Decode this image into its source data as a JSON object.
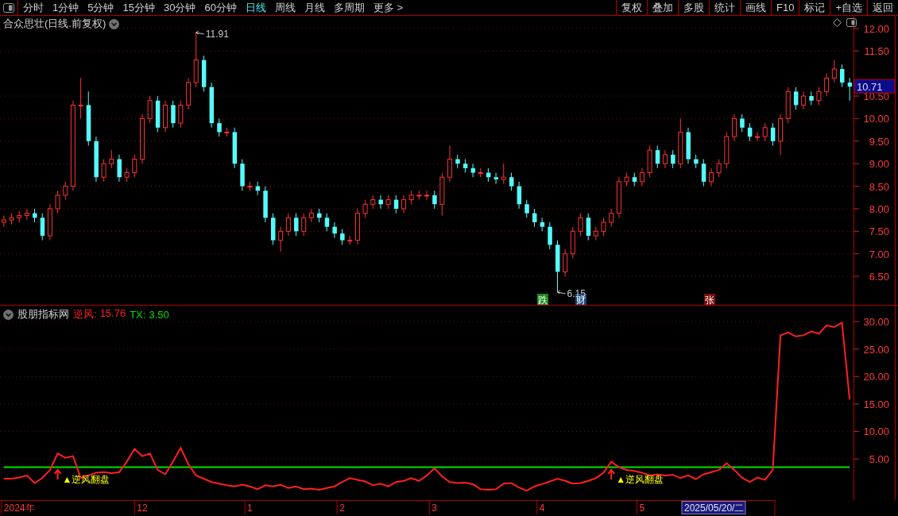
{
  "toolbar": {
    "periods": [
      {
        "label": "分时",
        "selected": false
      },
      {
        "label": "1分钟",
        "selected": false
      },
      {
        "label": "5分钟",
        "selected": false
      },
      {
        "label": "15分钟",
        "selected": false
      },
      {
        "label": "30分钟",
        "selected": false
      },
      {
        "label": "60分钟",
        "selected": false
      },
      {
        "label": "日线",
        "selected": true
      },
      {
        "label": "周线",
        "selected": false
      },
      {
        "label": "月线",
        "selected": false
      },
      {
        "label": "多周期",
        "selected": false
      },
      {
        "label": "更多 >",
        "selected": false
      }
    ],
    "actions": [
      "复权",
      "叠加",
      "多股",
      "统计",
      "画线",
      "F10",
      "标记",
      "+自选",
      "返回"
    ]
  },
  "price_panel": {
    "title": "合众思壮(日线.前复权)",
    "last_price": "10.71",
    "chart_data": {
      "type": "candlestick",
      "categories": [
        null,
        null,
        null,
        null,
        null,
        null,
        null,
        null,
        null,
        null,
        null,
        null,
        null,
        null,
        null,
        null,
        null,
        null,
        null,
        null,
        null,
        null,
        null,
        null,
        null,
        null,
        null,
        null,
        null,
        null,
        null,
        null,
        null,
        null,
        null,
        null,
        null,
        null,
        null,
        null,
        null,
        null,
        null,
        null,
        null,
        null,
        null,
        null,
        null,
        null,
        null,
        null,
        null,
        null,
        null,
        null,
        null,
        null,
        null,
        null,
        null,
        null,
        null,
        null,
        null,
        null,
        null,
        null,
        null,
        null,
        null,
        null,
        null,
        null,
        null,
        null,
        null,
        null,
        null,
        null,
        null,
        null,
        null,
        null,
        null,
        null,
        null,
        null,
        null,
        null,
        null,
        null,
        null,
        null,
        null,
        null,
        null,
        null,
        null,
        null,
        null,
        null,
        null,
        null,
        null,
        null,
        null,
        null,
        null,
        null,
        null
      ],
      "ohlc": [
        [
          7.7,
          7.85,
          7.6,
          7.75
        ],
        [
          7.75,
          7.9,
          7.65,
          7.8
        ],
        [
          7.8,
          7.95,
          7.7,
          7.85
        ],
        [
          7.85,
          8.0,
          7.75,
          7.9
        ],
        [
          7.9,
          8.0,
          7.7,
          7.8
        ],
        [
          7.8,
          7.9,
          7.3,
          7.4
        ],
        [
          7.4,
          8.1,
          7.3,
          8.0
        ],
        [
          8.0,
          8.4,
          7.9,
          8.3
        ],
        [
          8.3,
          8.6,
          8.2,
          8.5
        ],
        [
          8.5,
          10.4,
          8.4,
          10.3
        ],
        [
          10.3,
          10.9,
          10.0,
          10.3
        ],
        [
          10.3,
          10.6,
          9.4,
          9.5
        ],
        [
          9.5,
          9.6,
          8.6,
          8.7
        ],
        [
          8.7,
          9.1,
          8.6,
          9.0
        ],
        [
          9.0,
          9.3,
          8.9,
          9.1
        ],
        [
          9.1,
          9.2,
          8.6,
          8.7
        ],
        [
          8.7,
          8.9,
          8.6,
          8.8
        ],
        [
          8.8,
          9.2,
          8.7,
          9.1
        ],
        [
          9.1,
          10.1,
          9.0,
          10.0
        ],
        [
          10.0,
          10.5,
          9.9,
          10.4
        ],
        [
          10.4,
          10.5,
          9.7,
          9.8
        ],
        [
          9.8,
          10.4,
          9.7,
          10.3
        ],
        [
          10.3,
          10.4,
          9.8,
          9.9
        ],
        [
          9.9,
          10.4,
          9.8,
          10.3
        ],
        [
          10.3,
          10.9,
          10.2,
          10.8
        ],
        [
          10.8,
          11.91,
          10.7,
          11.3
        ],
        [
          11.3,
          11.4,
          10.6,
          10.7
        ],
        [
          10.7,
          10.8,
          9.8,
          9.9
        ],
        [
          9.9,
          10.0,
          9.6,
          9.7
        ],
        [
          9.7,
          9.8,
          9.6,
          9.7
        ],
        [
          9.7,
          9.8,
          8.9,
          9.0
        ],
        [
          9.0,
          9.1,
          8.4,
          8.5
        ],
        [
          8.5,
          8.6,
          8.4,
          8.5
        ],
        [
          8.5,
          8.6,
          8.3,
          8.4
        ],
        [
          8.4,
          8.5,
          7.7,
          7.8
        ],
        [
          7.8,
          7.9,
          7.2,
          7.3
        ],
        [
          7.3,
          7.6,
          7.05,
          7.5
        ],
        [
          7.5,
          7.9,
          7.4,
          7.8
        ],
        [
          7.8,
          7.9,
          7.4,
          7.5
        ],
        [
          7.5,
          7.9,
          7.4,
          7.8
        ],
        [
          7.8,
          8.0,
          7.7,
          7.9
        ],
        [
          7.9,
          8.0,
          7.7,
          7.8
        ],
        [
          7.8,
          7.9,
          7.5,
          7.6
        ],
        [
          7.6,
          7.7,
          7.35,
          7.45
        ],
        [
          7.45,
          7.55,
          7.2,
          7.3
        ],
        [
          7.3,
          7.4,
          7.2,
          7.3
        ],
        [
          7.3,
          8.0,
          7.2,
          7.9
        ],
        [
          7.9,
          8.2,
          7.8,
          8.1
        ],
        [
          8.1,
          8.3,
          8.0,
          8.2
        ],
        [
          8.2,
          8.3,
          8.0,
          8.1
        ],
        [
          8.1,
          8.3,
          8.0,
          8.2
        ],
        [
          8.2,
          8.3,
          7.9,
          8.0
        ],
        [
          8.0,
          8.3,
          7.9,
          8.2
        ],
        [
          8.2,
          8.4,
          8.1,
          8.3
        ],
        [
          8.3,
          8.4,
          8.2,
          8.3
        ],
        [
          8.3,
          8.4,
          8.2,
          8.3
        ],
        [
          8.3,
          8.4,
          8.0,
          8.1
        ],
        [
          8.1,
          8.8,
          7.85,
          8.7
        ],
        [
          8.7,
          9.4,
          8.6,
          9.1
        ],
        [
          9.1,
          9.2,
          8.9,
          9.0
        ],
        [
          9.0,
          9.1,
          8.8,
          8.9
        ],
        [
          8.9,
          9.0,
          8.7,
          8.8
        ],
        [
          8.8,
          8.9,
          8.7,
          8.8
        ],
        [
          8.8,
          8.9,
          8.6,
          8.7
        ],
        [
          8.7,
          8.8,
          8.55,
          8.65
        ],
        [
          8.65,
          9.0,
          8.55,
          8.7
        ],
        [
          8.7,
          8.8,
          8.4,
          8.5
        ],
        [
          8.5,
          8.6,
          8.0,
          8.1
        ],
        [
          8.1,
          8.2,
          7.8,
          7.9
        ],
        [
          7.9,
          8.0,
          7.6,
          7.7
        ],
        [
          7.7,
          7.8,
          7.5,
          7.6
        ],
        [
          7.6,
          7.7,
          7.1,
          7.2
        ],
        [
          7.2,
          7.3,
          6.15,
          6.6
        ],
        [
          6.6,
          7.1,
          6.5,
          7.0
        ],
        [
          7.0,
          7.6,
          6.9,
          7.5
        ],
        [
          7.5,
          7.9,
          7.4,
          7.8
        ],
        [
          7.8,
          7.9,
          7.3,
          7.4
        ],
        [
          7.4,
          7.6,
          7.3,
          7.5
        ],
        [
          7.5,
          7.8,
          7.4,
          7.7
        ],
        [
          7.7,
          8.0,
          7.6,
          7.9
        ],
        [
          7.9,
          8.7,
          7.8,
          8.6
        ],
        [
          8.6,
          8.8,
          8.5,
          8.7
        ],
        [
          8.7,
          8.8,
          8.5,
          8.6
        ],
        [
          8.6,
          8.9,
          8.5,
          8.8
        ],
        [
          8.8,
          9.4,
          8.7,
          9.3
        ],
        [
          9.3,
          9.4,
          8.9,
          9.0
        ],
        [
          9.0,
          9.3,
          8.9,
          9.2
        ],
        [
          9.2,
          9.3,
          8.9,
          9.0
        ],
        [
          9.0,
          10.0,
          8.9,
          9.7
        ],
        [
          9.7,
          9.8,
          9.0,
          9.1
        ],
        [
          9.1,
          9.2,
          8.9,
          9.0
        ],
        [
          9.0,
          9.1,
          8.5,
          8.6
        ],
        [
          8.6,
          8.9,
          8.5,
          8.8
        ],
        [
          8.8,
          9.1,
          8.7,
          9.0
        ],
        [
          9.0,
          9.7,
          8.9,
          9.6
        ],
        [
          9.6,
          10.1,
          9.5,
          10.0
        ],
        [
          10.0,
          10.1,
          9.7,
          9.8
        ],
        [
          9.8,
          9.9,
          9.5,
          9.6
        ],
        [
          9.6,
          9.7,
          9.5,
          9.6
        ],
        [
          9.6,
          9.9,
          9.5,
          9.8
        ],
        [
          9.8,
          9.9,
          9.4,
          9.5
        ],
        [
          9.5,
          10.1,
          9.2,
          10.0
        ],
        [
          10.0,
          10.7,
          9.9,
          10.6
        ],
        [
          10.6,
          10.7,
          10.2,
          10.3
        ],
        [
          10.3,
          10.6,
          10.2,
          10.5
        ],
        [
          10.5,
          10.6,
          10.3,
          10.4
        ],
        [
          10.4,
          10.7,
          10.3,
          10.6
        ],
        [
          10.6,
          11.0,
          10.5,
          10.9
        ],
        [
          10.9,
          11.3,
          10.8,
          11.1
        ],
        [
          11.1,
          11.2,
          10.7,
          10.8
        ],
        [
          10.8,
          10.9,
          10.4,
          10.71
        ]
      ],
      "ylim": [
        5.85,
        12.28
      ],
      "grid": true,
      "yticks": [
        {
          "value": 12,
          "label": "12.00"
        },
        {
          "value": 11.5,
          "label": "11.50"
        },
        {
          "value": 10.5,
          "label": "10.50"
        },
        {
          "value": 10,
          "label": "10.00"
        },
        {
          "value": 9.5,
          "label": "9.50"
        },
        {
          "value": 9,
          "label": "9.00"
        },
        {
          "value": 8.5,
          "label": "8.50"
        },
        {
          "value": 8,
          "label": "8.00"
        },
        {
          "value": 7.5,
          "label": "7.50"
        },
        {
          "value": 7,
          "label": "7.00"
        },
        {
          "value": 6.5,
          "label": "6.50"
        }
      ]
    },
    "extremes": [
      {
        "text": "11.91"
      },
      {
        "text": "6.15"
      }
    ],
    "event_badges": [
      {
        "text": "跌",
        "color": "#1c8a1c"
      },
      {
        "text": "财",
        "color": "#18477a"
      },
      {
        "text": "张",
        "color": "#7a0c0c"
      }
    ]
  },
  "indicator_panel": {
    "name": "股朋指标网",
    "readings": [
      "15.76",
      "3.50"
    ],
    "cursor_date": "2025/05/20/二",
    "chart_data": {
      "type": "line",
      "categories": [
        null,
        null,
        "2024年",
        null,
        null,
        null,
        null,
        null,
        null,
        null,
        null,
        null,
        null,
        null,
        null,
        null,
        null,
        null,
        "12",
        null,
        null,
        null,
        null,
        null,
        null,
        null,
        null,
        null,
        null,
        null,
        null,
        null,
        "1",
        null,
        null,
        null,
        null,
        null,
        null,
        null,
        null,
        null,
        null,
        null,
        "2",
        null,
        null,
        null,
        null,
        null,
        null,
        null,
        null,
        null,
        null,
        null,
        "3",
        null,
        null,
        null,
        null,
        null,
        null,
        null,
        null,
        null,
        null,
        null,
        null,
        null,
        "4",
        null,
        null,
        null,
        null,
        null,
        null,
        null,
        null,
        null,
        null,
        null,
        null,
        "5",
        null,
        null,
        null,
        null,
        null,
        null,
        null,
        null,
        null,
        null,
        null,
        null,
        null,
        null,
        null,
        null,
        null,
        null,
        null,
        null,
        null,
        null,
        null,
        null,
        null,
        null,
        null
      ],
      "series": [
        {
          "name": "逆风:",
          "color": "#ff2020",
          "values": [
            1.4,
            1.4,
            1.6,
            2.0,
            0.6,
            1.5,
            3.0,
            6.0,
            5.2,
            5.5,
            1.5,
            2.0,
            2.5,
            2.6,
            2.4,
            2.6,
            4.5,
            6.8,
            5.5,
            6.0,
            3.0,
            2.2,
            4.5,
            7.0,
            4.0,
            2.0,
            1.4,
            0.8,
            0.5,
            0.2,
            0.0,
            0.3,
            0.0,
            -0.5,
            0.2,
            0.0,
            0.3,
            -0.3,
            0.0,
            -0.5,
            -0.4,
            -0.6,
            -0.3,
            0.0,
            0.8,
            1.5,
            1.2,
            0.9,
            0.2,
            0.5,
            0.0,
            0.8,
            1.0,
            1.5,
            1.0,
            2.0,
            3.3,
            1.8,
            0.8,
            0.6,
            0.7,
            0.4,
            -0.5,
            -0.6,
            -0.5,
            0.5,
            0.6,
            -0.2,
            -0.8,
            0.0,
            0.4,
            0.9,
            1.4,
            1.0,
            0.5,
            0.6,
            1.0,
            1.5,
            2.5,
            4.5,
            3.5,
            3.0,
            2.8,
            2.5,
            2.0,
            2.2,
            2.0,
            2.1,
            1.5,
            2.0,
            1.3,
            2.2,
            2.6,
            3.0,
            4.2,
            3.0,
            1.6,
            0.8,
            1.6,
            1.2,
            3.0,
            27.5,
            28.0,
            27.3,
            27.5,
            28.2,
            27.8,
            29.3,
            29.0,
            29.8,
            15.8
          ]
        },
        {
          "name": "TX:",
          "color": "#00e000",
          "values": [
            3.5,
            3.5,
            3.5,
            3.5,
            3.5,
            3.5,
            3.5,
            3.5,
            3.5,
            3.5,
            3.5,
            3.5,
            3.5,
            3.5,
            3.5,
            3.5,
            3.5,
            3.5,
            3.5,
            3.5,
            3.5,
            3.5,
            3.5,
            3.5,
            3.5,
            3.5,
            3.5,
            3.5,
            3.5,
            3.5,
            3.5,
            3.5,
            3.5,
            3.5,
            3.5,
            3.5,
            3.5,
            3.5,
            3.5,
            3.5,
            3.5,
            3.5,
            3.5,
            3.5,
            3.5,
            3.5,
            3.5,
            3.5,
            3.5,
            3.5,
            3.5,
            3.5,
            3.5,
            3.5,
            3.5,
            3.5,
            3.5,
            3.5,
            3.5,
            3.5,
            3.5,
            3.5,
            3.5,
            3.5,
            3.5,
            3.5,
            3.5,
            3.5,
            3.5,
            3.5,
            3.5,
            3.5,
            3.5,
            3.5,
            3.5,
            3.5,
            3.5,
            3.5,
            3.5,
            3.5,
            3.5,
            3.5,
            3.5,
            3.5,
            3.5,
            3.5,
            3.5,
            3.5,
            3.5,
            3.5,
            3.5,
            3.5,
            3.5,
            3.5,
            3.5,
            3.5,
            3.5,
            3.5,
            3.5,
            3.5,
            3.5,
            3.5,
            3.5,
            3.5,
            3.5,
            3.5,
            3.5,
            3.5,
            3.5,
            3.5,
            3.5
          ]
        }
      ],
      "ylim": [
        -2.5,
        32.9
      ],
      "grid": true,
      "yticks": [
        {
          "value": 30,
          "label": "30.00"
        },
        {
          "value": 25,
          "label": "25.00"
        },
        {
          "value": 20,
          "label": "20.00"
        },
        {
          "value": 15,
          "label": "15.00"
        },
        {
          "value": 10,
          "label": "10.00"
        },
        {
          "value": 5,
          "label": "5.00"
        }
      ]
    },
    "signals": [
      {
        "text": "▲逆风翻盘"
      },
      {
        "text": "▲逆风翻盘"
      }
    ]
  }
}
